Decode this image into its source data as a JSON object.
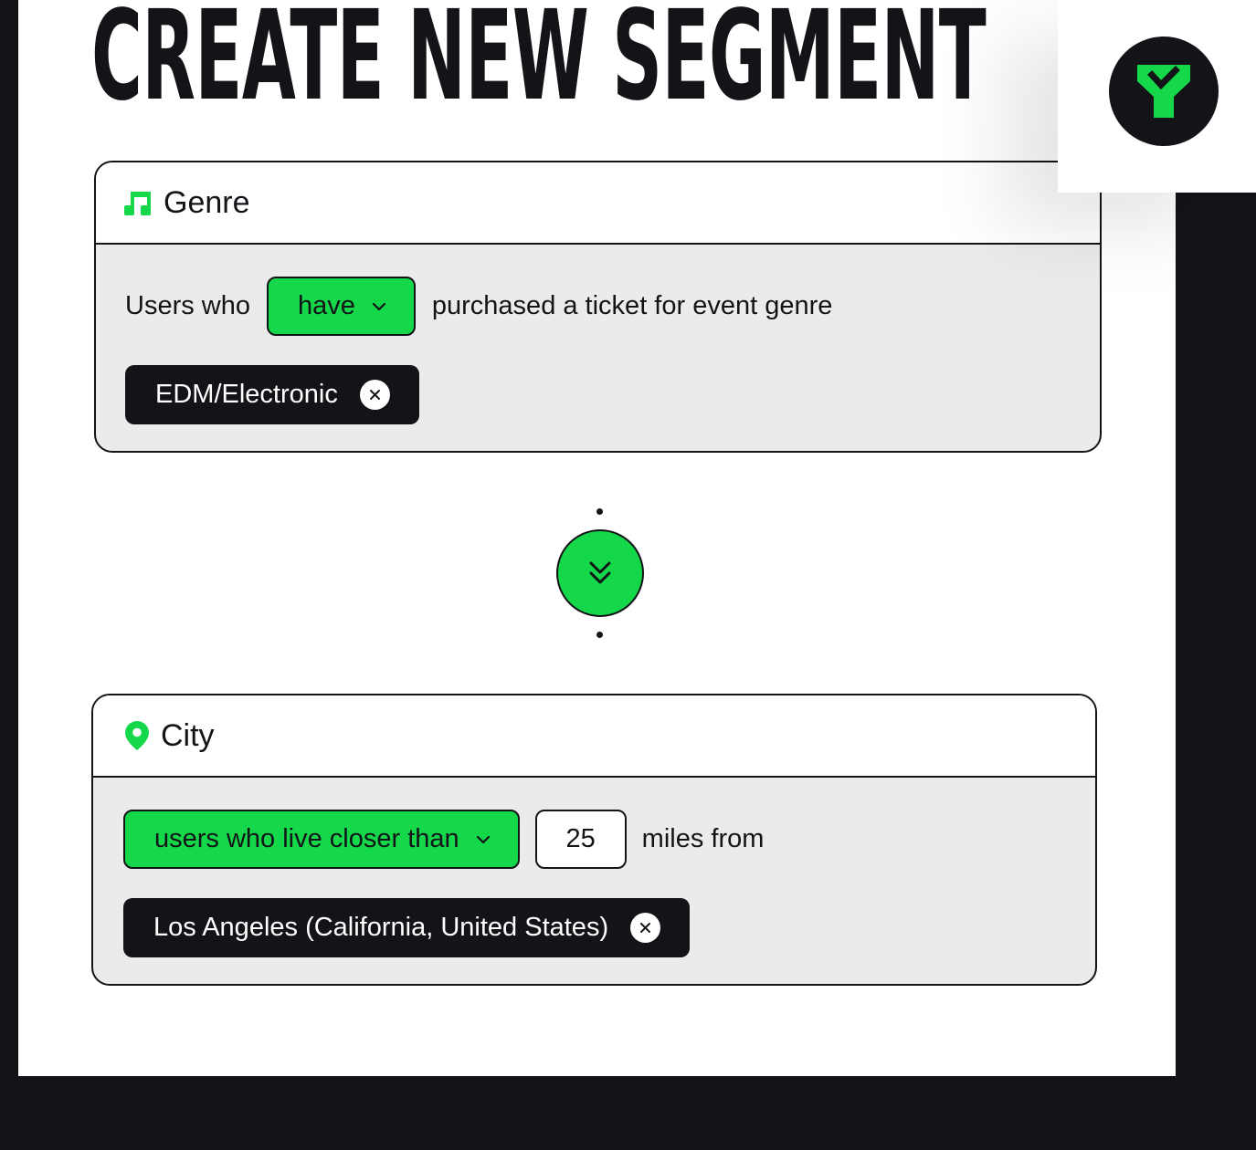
{
  "page": {
    "title": "CREATE NEW SEGMENT"
  },
  "logo": {
    "icon": "y-checkmark-logo-icon"
  },
  "colors": {
    "accent_green": "#14d84a",
    "dark": "#131418",
    "card_background": "#ebebeb"
  },
  "genre_card": {
    "icon": "music-note-icon",
    "title": "Genre",
    "prefix_text": "Users who",
    "condition_dropdown": "have",
    "suffix_text": "purchased a ticket for event genre",
    "selected_tag": "EDM/Electronic"
  },
  "connector": {
    "icon": "chevron-double-down-icon"
  },
  "city_card": {
    "icon": "map-pin-icon",
    "title": "City",
    "condition_dropdown": "users who live closer than",
    "distance_value": "25",
    "suffix_text": "miles from",
    "selected_tag": "Los Angeles (California, United States)"
  }
}
